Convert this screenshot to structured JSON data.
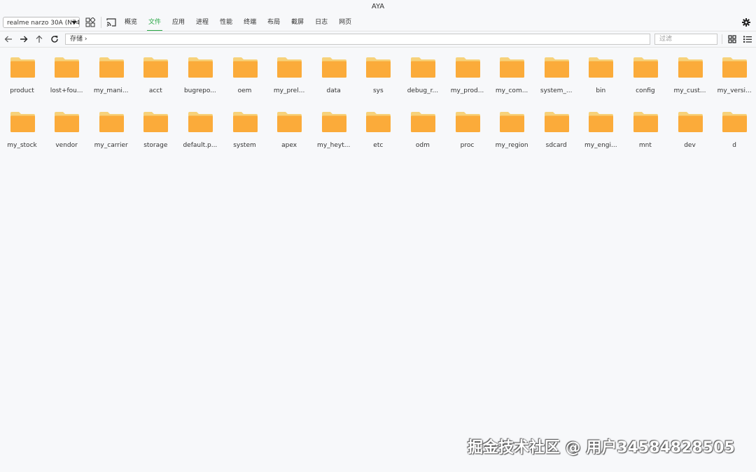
{
  "window": {
    "title": "AYA"
  },
  "toolbar": {
    "device": "realme narzo 30A (N74",
    "tabs": [
      "概览",
      "文件",
      "应用",
      "进程",
      "性能",
      "终端",
      "布局",
      "截屏",
      "日志",
      "网页"
    ],
    "active_tab": "文件"
  },
  "navbar": {
    "path": "存储 ›",
    "filter_placeholder": "过滤"
  },
  "colors": {
    "accent": "#28a745",
    "folder_front": "#fbab3a",
    "folder_back": "#f7d27a"
  },
  "files": {
    "row1": [
      "product",
      "lost+fou...",
      "my_mani...",
      "acct",
      "bugrepo...",
      "oem",
      "my_prel...",
      "data",
      "sys",
      "debug_r...",
      "my_prod...",
      "my_com...",
      "system_...",
      "bin",
      "config",
      "my_cust...",
      "my_versi..."
    ],
    "row2": [
      "my_stock",
      "vendor",
      "my_carrier",
      "storage",
      "default.p...",
      "system",
      "apex",
      "my_heyt...",
      "etc",
      "odm",
      "proc",
      "my_region",
      "sdcard",
      "my_engi...",
      "mnt",
      "dev",
      "d"
    ]
  },
  "watermark": "掘金技术社区 @ 用户34584828505"
}
